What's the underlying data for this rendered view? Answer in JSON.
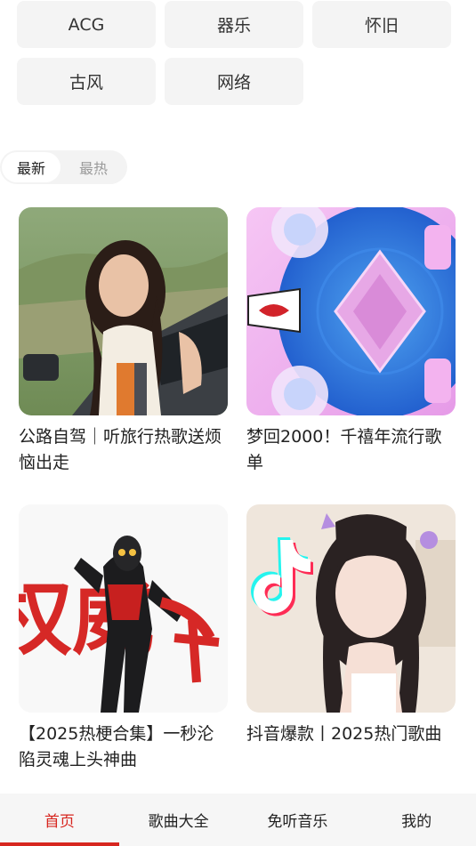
{
  "tags": [
    "ACG",
    "器乐",
    "怀旧",
    "古风",
    "网络"
  ],
  "sort": {
    "active": "最新",
    "inactive": "最热"
  },
  "playlists": [
    {
      "title": "公路自驾｜听旅行热歌送烦恼出走",
      "cover_icon": "portrait-roadtrip-image"
    },
    {
      "title": "梦回2000！千禧年流行歌单",
      "cover_icon": "y2k-abstract-image"
    },
    {
      "title": "【2025热梗合集】一秒沦陷灵魂上头神曲",
      "cover_icon": "ultraman-calligraphy-image",
      "cover_text": "权威"
    },
    {
      "title": "抖音爆款丨2025热门歌曲",
      "cover_icon": "tiktok-girl-image"
    }
  ],
  "nav": [
    {
      "label": "首页",
      "active": true
    },
    {
      "label": "歌曲大全",
      "active": false
    },
    {
      "label": "免听音乐",
      "active": false
    },
    {
      "label": "我的",
      "active": false
    }
  ],
  "colors": {
    "accent": "#d7261f",
    "tag_bg": "#f4f4f4",
    "nav_bg": "#f6f6f6"
  }
}
